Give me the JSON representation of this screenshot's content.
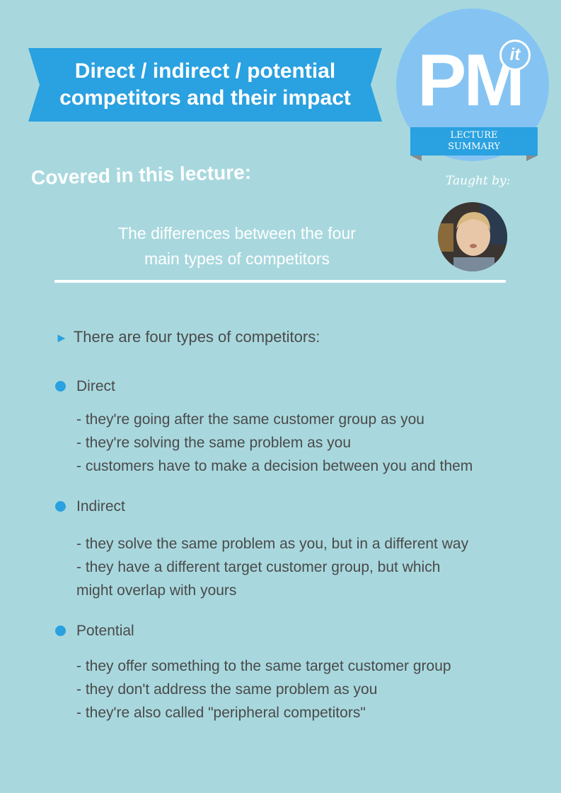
{
  "banner": {
    "line1": "Direct / indirect / potential",
    "line2": "competitors and their impact",
    "color": "#2aa1e0"
  },
  "logo": {
    "pm": "PM",
    "it": "it",
    "ribbon_line1": "LECTURE",
    "ribbon_line2": "SUMMARY"
  },
  "covered": {
    "title": "Covered in this lecture:",
    "subtitle_line1": "The differences between the four",
    "subtitle_line2": "main types of competitors"
  },
  "taught_by": "Taught by:",
  "intro": "There are four types of competitors:",
  "sections": [
    {
      "heading": "Direct",
      "lines": [
        "- they're going after the same customer group as you",
        "- they're solving the same problem as you",
        "- customers have to make a decision between you and them"
      ]
    },
    {
      "heading": "Indirect",
      "lines": [
        "- they solve the same problem as you, but in a different way",
        "- they have a different target customer group, but which",
        "might overlap with yours"
      ]
    },
    {
      "heading": "Potential",
      "lines": [
        "- they offer something to the same target customer group",
        "- they don't address the same problem as you",
        "- they're also called \"peripheral competitors\""
      ]
    }
  ]
}
